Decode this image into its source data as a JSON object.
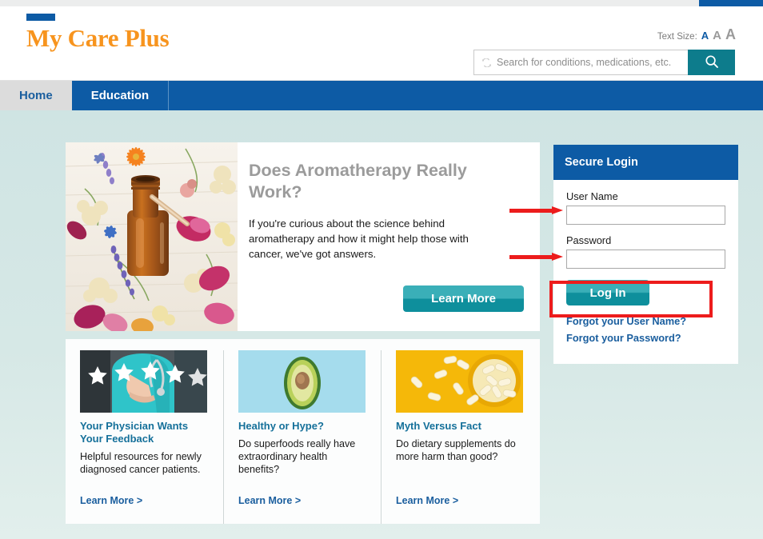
{
  "browser": {
    "tab_label": ""
  },
  "header": {
    "logo": {
      "name": "My Care Plus",
      "bar_color": "#0d5ba5",
      "text_color": "#f7941e"
    },
    "text_size": {
      "label": "Text Size:",
      "options": [
        "A",
        "A",
        "A"
      ],
      "selected_index": 0,
      "selected_color": "#0d5ba5",
      "unselected_color": "#9a9a9a"
    },
    "search": {
      "placeholder": "Search for conditions, medications, etc.",
      "value": "",
      "button_icon": "search-icon",
      "button_color": "#0d7c8c",
      "left_icon": "broken-image-icon"
    }
  },
  "nav": {
    "background": "#0d5ba5",
    "items": [
      {
        "label": "Home",
        "active": true
      },
      {
        "label": "Education",
        "active": false
      }
    ]
  },
  "hero": {
    "image_alt": "amber essential oil bottle surrounded by dried flowers",
    "title": "Does Aromatherapy Really Work?",
    "body": "If you're curious about the science behind aromatherapy and how it might help those with cancer, we've got answers.",
    "button_label": "Learn More",
    "title_color": "#9b9b9b",
    "button_color": "#0e8f9c"
  },
  "cards": [
    {
      "image_alt": "doctor in teal scrubs with five white stars",
      "title": "Your Physician Wants Your Feedback",
      "text": "Helpful resources for newly diagnosed cancer patients.",
      "link_label": "Learn More >"
    },
    {
      "image_alt": "halved avocado on light blue background",
      "title": "Healthy or Hype?",
      "text": "Do superfoods really have extraordinary health benefits?",
      "link_label": "Learn More >"
    },
    {
      "image_alt": "white capsules spilling from a yellow bowl on yellow background",
      "title": "Myth Versus Fact",
      "text": "Do dietary supplements do more harm than good?",
      "link_label": "Learn More >"
    }
  ],
  "login": {
    "header_title": "Secure Login",
    "username_label": "User Name",
    "username_value": "",
    "password_label": "Password",
    "password_value": "",
    "submit_label": "Log In",
    "forgot_username_label": "Forgot your User Name?",
    "forgot_password_label": "Forgot your Password?",
    "header_color": "#0d5ba5",
    "link_color": "#1a5e9e"
  },
  "annotations": {
    "color": "#ed1c1c",
    "arrow_targets": [
      "User Name field",
      "Password field"
    ],
    "highlight_target": "Log In button"
  }
}
